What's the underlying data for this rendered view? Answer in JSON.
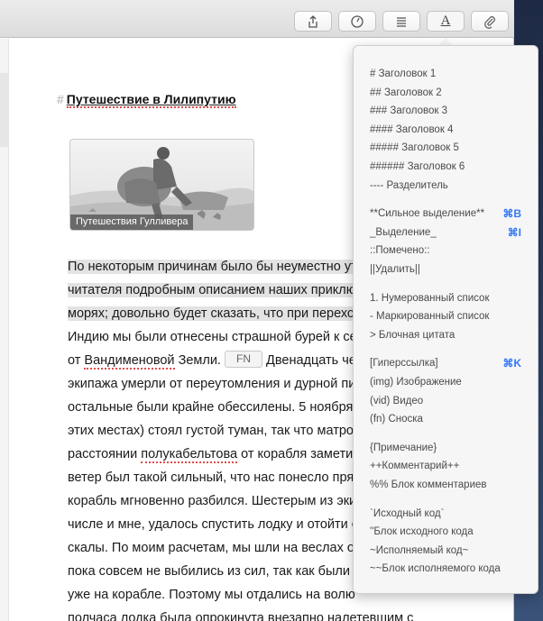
{
  "toolbar": {
    "buttons": [
      {
        "name": "share-button",
        "icon": "share-icon"
      },
      {
        "name": "info-button",
        "icon": "gauge-icon"
      },
      {
        "name": "outline-button",
        "icon": "list-icon"
      },
      {
        "name": "format-button",
        "icon": "text-format-icon",
        "glyph": "A"
      },
      {
        "name": "attach-button",
        "icon": "paperclip-icon"
      }
    ]
  },
  "editor": {
    "heading_marker": "#",
    "heading": "Путешествие в Лилипутию",
    "image_caption": "Путешествия Гулливера",
    "lines": [
      {
        "text": "По некоторым причинам было бы неуместно ут",
        "highlight": true
      },
      {
        "text": "читателя подробным описанием наших приклю",
        "highlight": true
      },
      {
        "text": "морях; довольно будет сказать, что при перехо",
        "highlight": "partial",
        "hl_part": "морях; довольно будет сказать, что при перехо"
      },
      {
        "text": "Индию мы были отнесены страшной бурей к се"
      },
      {
        "pre": "от ",
        "spell": "Вандименовой",
        "post": " Земли.",
        "chip": "FN",
        "tail": " Двенадцать че"
      },
      {
        "text": "экипажа умерли от переутомления и дурной пи"
      },
      {
        "text": "остальные были крайне обессилены. 5 ноября"
      },
      {
        "text": "этих местах) стоял густой туман, так что матро"
      },
      {
        "pre": "расстоянии ",
        "spell": "полукабельтова",
        "post": " от корабля заметил"
      },
      {
        "text": "ветер был такой сильный, что нас понесло прям"
      },
      {
        "text": "корабль мгновенно разбился. Шестерым из эки"
      },
      {
        "text": "числе и мне, удалось спустить лодку и отойти с"
      },
      {
        "text": "скалы. По моим расчетам, мы шли на веслах ок"
      },
      {
        "text": "пока совсем не выбились из сил, так как были"
      },
      {
        "text": "уже на корабле. Поэтому мы отдались на волю"
      },
      {
        "text": "полчаса лодка была опрокинута внезапно налетевшим с"
      }
    ]
  },
  "format_menu": {
    "groups": [
      [
        {
          "label": "# Заголовок 1"
        },
        {
          "label": "## Заголовок 2"
        },
        {
          "label": "### Заголовок 3"
        },
        {
          "label": "#### Заголовок 4"
        },
        {
          "label": "##### Заголовок 5"
        },
        {
          "label": "###### Заголовок 6"
        },
        {
          "label": "---- Разделитель"
        }
      ],
      [
        {
          "label": "**Сильное выделение**",
          "shortcut": "⌘B"
        },
        {
          "label": "_Выделение_",
          "shortcut": "⌘I"
        },
        {
          "label": "::Помечено::"
        },
        {
          "label": "||Удалить||"
        }
      ],
      [
        {
          "label": "1. Нумерованный список"
        },
        {
          "label": "- Маркированный список"
        },
        {
          "label": "> Блочная цитата"
        }
      ],
      [
        {
          "label": "[Гиперссылка]",
          "shortcut": "⌘K"
        },
        {
          "label": "(img) Изображение"
        },
        {
          "label": "(vid) Видео"
        },
        {
          "label": "(fn) Сноска"
        }
      ],
      [
        {
          "label": "{Примечание}"
        },
        {
          "label": "++Комментарий++"
        },
        {
          "label": "%% Блок комментариев"
        }
      ],
      [
        {
          "label": "`Исходный код`"
        },
        {
          "label": "''Блок исходного кода"
        },
        {
          "label": "~Исполняемый код~"
        },
        {
          "label": "~~Блок исполняемого кода"
        }
      ]
    ]
  },
  "colors": {
    "accent": "#3478f6",
    "spellcheck": "#e24b4b",
    "highlight": "#e3e3e3"
  }
}
